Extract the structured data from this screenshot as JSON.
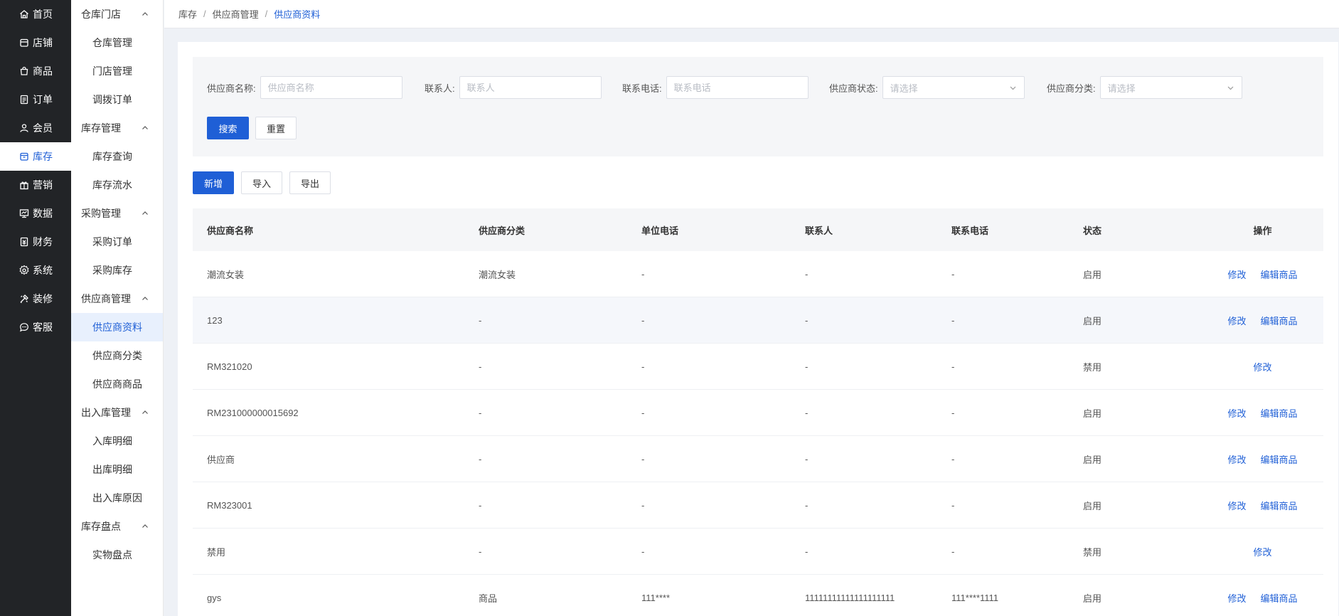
{
  "primary_nav": [
    {
      "label": "首页",
      "icon": "home-icon"
    },
    {
      "label": "店铺",
      "icon": "store-icon"
    },
    {
      "label": "商品",
      "icon": "product-icon"
    },
    {
      "label": "订单",
      "icon": "order-icon"
    },
    {
      "label": "会员",
      "icon": "member-icon"
    },
    {
      "label": "库存",
      "icon": "inventory-icon",
      "active": true
    },
    {
      "label": "营销",
      "icon": "marketing-icon"
    },
    {
      "label": "数据",
      "icon": "data-icon"
    },
    {
      "label": "财务",
      "icon": "finance-icon"
    },
    {
      "label": "系统",
      "icon": "settings-icon"
    },
    {
      "label": "装修",
      "icon": "decorate-icon"
    },
    {
      "label": "客服",
      "icon": "chat-icon"
    }
  ],
  "secondary_nav": {
    "groups": [
      {
        "title": "仓库门店",
        "items": [
          "仓库管理",
          "门店管理",
          "调拨订单"
        ]
      },
      {
        "title": "库存管理",
        "items": [
          "库存查询",
          "库存流水"
        ]
      },
      {
        "title": "采购管理",
        "items": [
          "采购订单",
          "采购库存"
        ]
      },
      {
        "title": "供应商管理",
        "items": [
          "供应商资料",
          "供应商分类",
          "供应商商品"
        ]
      },
      {
        "title": "出入库管理",
        "items": [
          "入库明细",
          "出库明细",
          "出入库原因"
        ]
      },
      {
        "title": "库存盘点",
        "items": [
          "实物盘点"
        ]
      }
    ],
    "active_item": "供应商资料"
  },
  "breadcrumb": {
    "items": [
      "库存",
      "供应商管理"
    ],
    "current": "供应商资料",
    "separator": "/"
  },
  "filters": {
    "supplier_name": {
      "label": "供应商名称:",
      "placeholder": "供应商名称",
      "value": ""
    },
    "contact": {
      "label": "联系人:",
      "placeholder": "联系人",
      "value": ""
    },
    "contact_phone": {
      "label": "联系电话:",
      "placeholder": "联系电话",
      "value": ""
    },
    "supplier_status": {
      "label": "供应商状态:",
      "placeholder": "请选择"
    },
    "supplier_category": {
      "label": "供应商分类:",
      "placeholder": "请选择"
    },
    "search_label": "搜索",
    "reset_label": "重置"
  },
  "actions": {
    "add_label": "新增",
    "import_label": "导入",
    "export_label": "导出"
  },
  "table": {
    "columns": [
      "供应商名称",
      "供应商分类",
      "单位电话",
      "联系人",
      "联系电话",
      "状态",
      "操作"
    ],
    "rows": [
      {
        "name": "潮流女装",
        "category": "潮流女装",
        "unit_phone": "-",
        "contact": "-",
        "phone": "-",
        "status": "启用",
        "edit": "修改",
        "edit_goods": "编辑商品"
      },
      {
        "name": "123",
        "category": "-",
        "unit_phone": "-",
        "contact": "-",
        "phone": "-",
        "status": "启用",
        "edit": "修改",
        "edit_goods": "编辑商品"
      },
      {
        "name": "RM321020",
        "category": "-",
        "unit_phone": "-",
        "contact": "-",
        "phone": "-",
        "status": "禁用",
        "edit": "修改",
        "edit_goods": ""
      },
      {
        "name": "RM231000000015692",
        "category": "-",
        "unit_phone": "-",
        "contact": "-",
        "phone": "-",
        "status": "启用",
        "edit": "修改",
        "edit_goods": "编辑商品"
      },
      {
        "name": "供应商",
        "category": "-",
        "unit_phone": "-",
        "contact": "-",
        "phone": "-",
        "status": "启用",
        "edit": "修改",
        "edit_goods": "编辑商品"
      },
      {
        "name": "RM323001",
        "category": "-",
        "unit_phone": "-",
        "contact": "-",
        "phone": "-",
        "status": "启用",
        "edit": "修改",
        "edit_goods": "编辑商品"
      },
      {
        "name": "禁用",
        "category": "-",
        "unit_phone": "-",
        "contact": "-",
        "phone": "-",
        "status": "禁用",
        "edit": "修改",
        "edit_goods": ""
      },
      {
        "name": "gys",
        "category": "商品",
        "unit_phone": "111****",
        "contact": "11111111111111111111",
        "phone": "111****1111",
        "status": "启用",
        "edit": "修改",
        "edit_goods": "编辑商品"
      }
    ]
  },
  "colors": {
    "accent": "#1f5fd6",
    "sidebar_bg": "#222427",
    "active_sub_bg": "#e8f0fd"
  }
}
